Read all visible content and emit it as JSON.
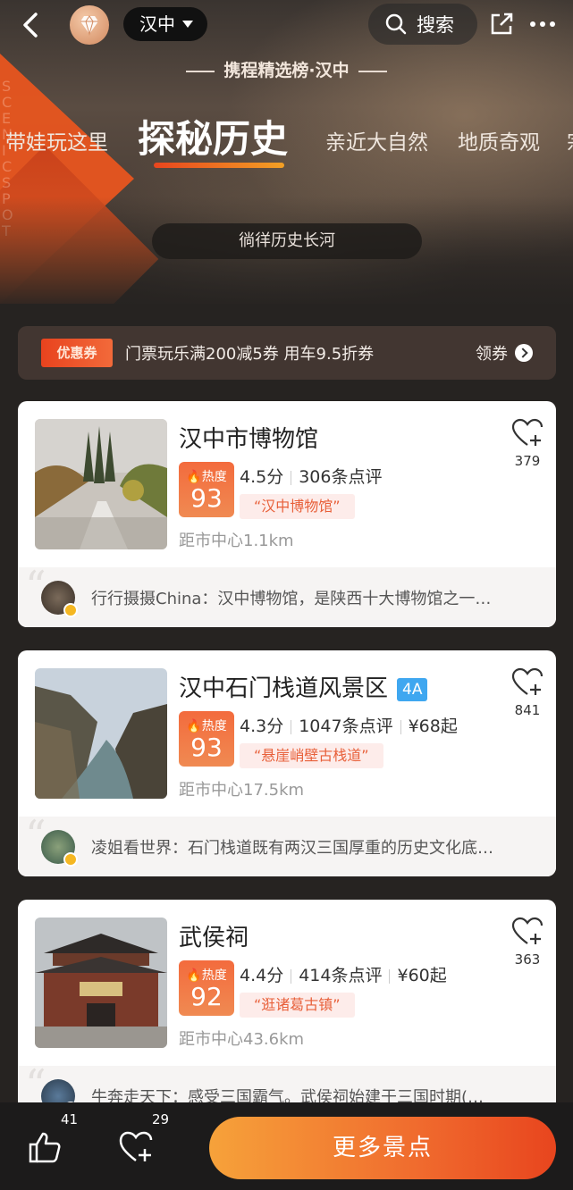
{
  "header": {
    "city": "汉中",
    "search_label": "搜索"
  },
  "list_title": {
    "text": "携程精选榜",
    "city": "·汉中"
  },
  "hero_vertical_text": "SCENIC SPOT",
  "tabs": [
    {
      "label": "带娃玩这里",
      "active": false
    },
    {
      "label": "探秘历史",
      "active": true
    },
    {
      "label": "亲近大自然",
      "active": false
    },
    {
      "label": "地质奇观",
      "active": false
    },
    {
      "label": "宗",
      "active": false
    }
  ],
  "subtitle": "徜徉历史长河",
  "coupon": {
    "badge": "优惠券",
    "text": "门票玩乐满200减5券  用车9.5折券",
    "action": "领券"
  },
  "cards": [
    {
      "name": "汉中市博物馆",
      "level": "",
      "heat_label": "热度",
      "heat_value": "93",
      "score": "4.5分",
      "reviews": "306条点评",
      "price": "",
      "tag": "“汉中博物馆”",
      "distance": "距市中心1.1km",
      "fav_count": "379",
      "review_text": "行行摄摄China：汉中博物馆，是陕西十大博物馆之一…"
    },
    {
      "name": "汉中石门栈道风景区",
      "level": "4A",
      "heat_label": "热度",
      "heat_value": "93",
      "score": "4.3分",
      "reviews": "1047条点评",
      "price": "¥68起",
      "tag": "“悬崖峭壁古栈道”",
      "distance": "距市中心17.5km",
      "fav_count": "841",
      "review_text": "凌姐看世界：石门栈道既有两汉三国厚重的历史文化底…"
    },
    {
      "name": "武侯祠",
      "level": "",
      "heat_label": "热度",
      "heat_value": "92",
      "score": "4.4分",
      "reviews": "414条点评",
      "price": "¥60起",
      "tag": "“逛诸葛古镇”",
      "distance": "距市中心43.6km",
      "fav_count": "363",
      "review_text": "牛奔走天下：感受三国霸气。武侯祠始建于三国时期(…"
    }
  ],
  "bottom": {
    "like_count": "41",
    "fav_count": "29",
    "more_button": "更多景点"
  },
  "colors": {
    "accent": "#e8451e",
    "heat": "#f36b3d",
    "level_badge": "#3fa7f0",
    "tag_text": "#e8603a"
  }
}
